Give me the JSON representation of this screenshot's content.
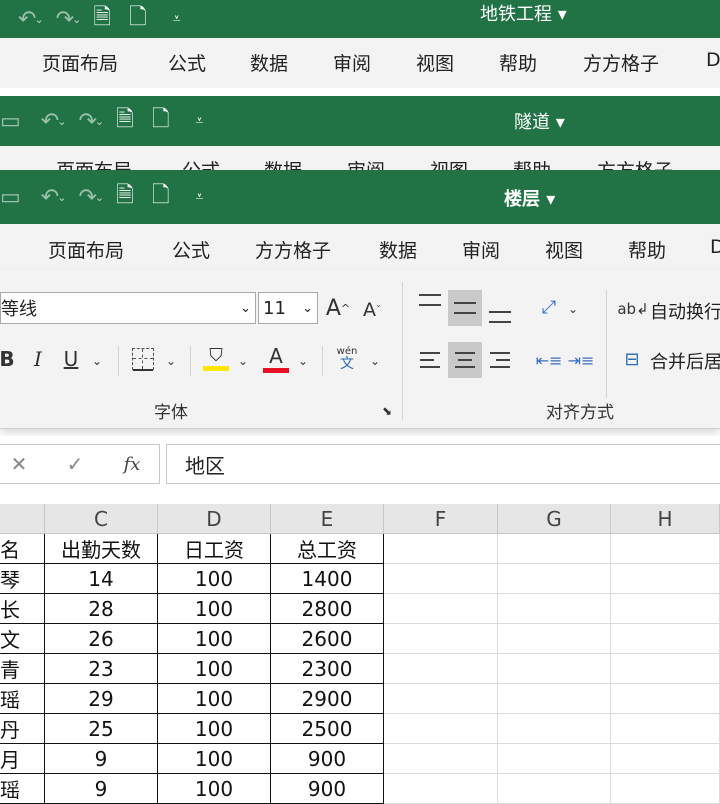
{
  "window1": {
    "title": "地铁工程 ▾",
    "tabs": [
      "页面布局",
      "公式",
      "数据",
      "审阅",
      "视图",
      "帮助",
      "方方格子",
      "D"
    ]
  },
  "window2": {
    "title": "隧道 ▾",
    "tabs": [
      "页面布局",
      "公式",
      "数据",
      "审阅",
      "视图",
      "帮助",
      "方方格子"
    ]
  },
  "window3": {
    "title": "楼层 ▾",
    "tabs": [
      "页面布局",
      "公式",
      "方方格子",
      "数据",
      "审阅",
      "视图",
      "帮助",
      "D"
    ],
    "font_name": "等线",
    "font_size": "11",
    "group_font": "字体",
    "group_align": "对齐方式",
    "wrap_text": "自动换行",
    "merge_center": "合并后居",
    "phonetic_top": "wén",
    "phonetic_bottom": "文"
  },
  "formula_bar": {
    "content": "地区"
  },
  "sheet": {
    "columns": [
      "C",
      "D",
      "E",
      "F",
      "G",
      "H"
    ],
    "header_row": [
      "名",
      "出勤天数",
      "日工资",
      "总工资"
    ],
    "rows": [
      [
        "琴",
        "14",
        "100",
        "1400"
      ],
      [
        "长",
        "28",
        "100",
        "2800"
      ],
      [
        "文",
        "26",
        "100",
        "2600"
      ],
      [
        "青",
        "23",
        "100",
        "2300"
      ],
      [
        "瑶",
        "29",
        "100",
        "2900"
      ],
      [
        "丹",
        "25",
        "100",
        "2500"
      ],
      [
        "月",
        "9",
        "100",
        "900"
      ],
      [
        "瑶",
        "9",
        "100",
        "900"
      ]
    ]
  },
  "colors": {
    "excel_green": "#217346",
    "fill_yellow": "#ffe600",
    "font_red": "#e81123"
  }
}
